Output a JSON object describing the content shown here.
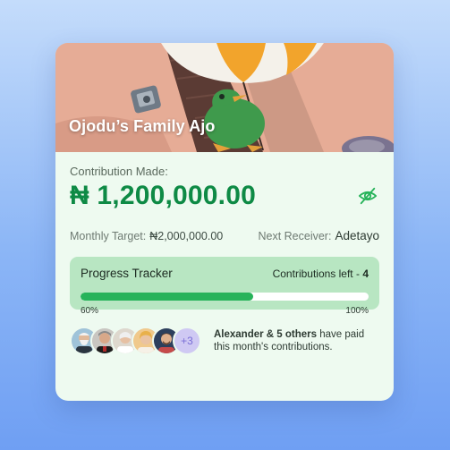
{
  "card": {
    "title": "Ojodu’s Family Ajo",
    "contribution_label": "Contribution Made:",
    "contribution_amount": "₦ 1,200,000.00",
    "monthly_target_label": "Monthly Target:",
    "monthly_target_value": "₦2,000,000.00",
    "next_receiver_label": "Next Receiver:",
    "next_receiver_value": "Adetayo"
  },
  "tracker": {
    "title": "Progress Tracker",
    "contributions_left_label": "Contributions left - ",
    "contributions_left_value": "4",
    "progress_percent": 60,
    "progress_label": "60%",
    "max_label": "100%"
  },
  "members": {
    "more_count": "+3",
    "paid_name": "Alexander & 5 others",
    "paid_suffix": " have paid this month's contributions."
  },
  "colors": {
    "accent_green": "#0e8a45",
    "progress_fill": "#27b35a",
    "tracker_bg": "#b8e6c2",
    "card_bg": "#eefaf0"
  },
  "icons": {
    "visibility_toggle": "eye-off-icon"
  }
}
